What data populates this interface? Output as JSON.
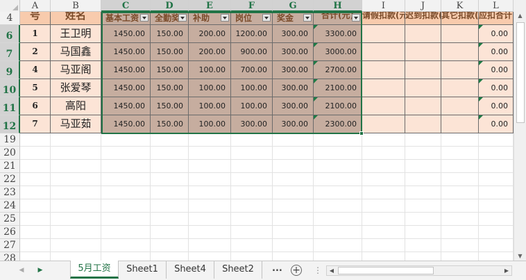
{
  "sheet": {
    "column_letters": [
      "A",
      "B",
      "C",
      "D",
      "E",
      "F",
      "G",
      "H",
      "I",
      "J",
      "K",
      "L"
    ],
    "selected_columns": [
      "C",
      "D",
      "E",
      "F",
      "G",
      "H"
    ],
    "row_numbers": [
      "4",
      "6",
      "7",
      "9",
      "10",
      "11",
      "12",
      "19",
      "20",
      "21",
      "22",
      "23",
      "24",
      "25",
      "26",
      "27",
      "28"
    ],
    "selected_rows": [
      "6",
      "7",
      "9",
      "10",
      "11",
      "12"
    ],
    "header_row": {
      "a": "号",
      "b": "姓名",
      "c": "基本工资",
      "d": "全勤奖",
      "e": "补助",
      "f": "岗位",
      "g": "奖金",
      "h": "合计(元)",
      "i": "请假扣款(元)",
      "j": "迟到扣款(元)",
      "k": "其它扣款(元)",
      "l": "应扣合计(元)"
    },
    "rows": [
      {
        "id": "1",
        "name": "王卫明",
        "c": "1450.00",
        "d": "150.00",
        "e": "200.00",
        "f": "1200.00",
        "g": "300.00",
        "h": "3300.00",
        "l": "0.00"
      },
      {
        "id": "2",
        "name": "马国鑫",
        "c": "1450.00",
        "d": "150.00",
        "e": "200.00",
        "f": "900.00",
        "g": "300.00",
        "h": "3000.00",
        "l": "0.00"
      },
      {
        "id": "4",
        "name": "马亚阁",
        "c": "1450.00",
        "d": "150.00",
        "e": "100.00",
        "f": "700.00",
        "g": "300.00",
        "h": "2700.00",
        "l": "0.00"
      },
      {
        "id": "5",
        "name": "张爱琴",
        "c": "1450.00",
        "d": "150.00",
        "e": "100.00",
        "f": "100.00",
        "g": "300.00",
        "h": "2100.00",
        "l": "0.00"
      },
      {
        "id": "6",
        "name": "高阳",
        "c": "1450.00",
        "d": "150.00",
        "e": "100.00",
        "f": "100.00",
        "g": "300.00",
        "h": "2100.00",
        "l": "0.00"
      },
      {
        "id": "7",
        "name": "马亚茹",
        "c": "1450.00",
        "d": "150.00",
        "e": "100.00",
        "f": "300.00",
        "g": "300.00",
        "h": "2300.00",
        "l": "0.00"
      }
    ]
  },
  "tabs": [
    "5月工资",
    "Sheet1",
    "Sheet4",
    "Sheet2"
  ],
  "active_tab": "5月工资",
  "tab_more": "...",
  "add_sheet": "+",
  "colors": {
    "accent": "#217346",
    "header_fill": "#f8cbad",
    "row_fill": "#fce4d6",
    "selected_fill": "#c6ad9f"
  }
}
